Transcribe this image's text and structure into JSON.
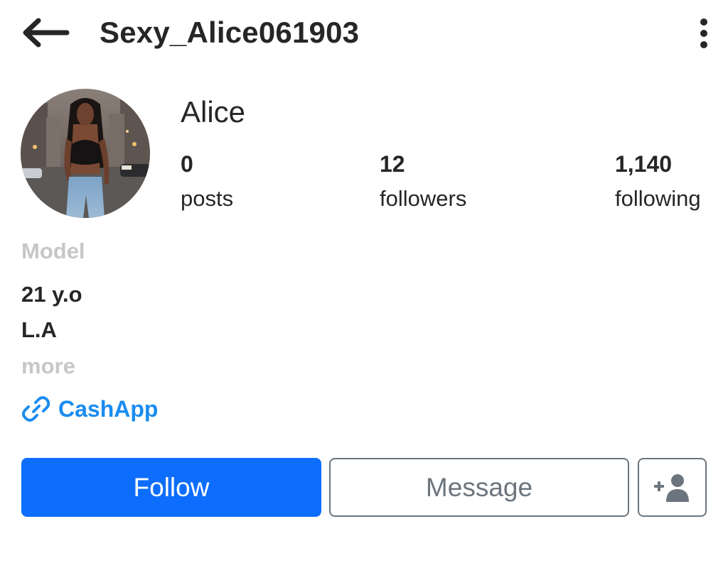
{
  "header": {
    "back_icon": "arrow-left-icon",
    "username": "Sexy_Alice061903",
    "more_icon": "kebab-vertical-icon"
  },
  "profile": {
    "avatar_icon": "profile-photo",
    "display_name": "Alice",
    "stats": [
      {
        "value": "0",
        "label": "posts"
      },
      {
        "value": "12",
        "label": "followers"
      },
      {
        "value": "1,140",
        "label": "following"
      }
    ]
  },
  "bio": {
    "category": "Model",
    "lines": [
      "21 y.o",
      "L.A"
    ],
    "more_label": "more",
    "link_icon": "link-icon",
    "link_label": "CashApp"
  },
  "actions": {
    "follow_label": "Follow",
    "message_label": "Message",
    "add_user_icon": "add-user-icon"
  },
  "colors": {
    "primary": "#0d6efd",
    "link": "#1a8cf0",
    "muted": "#c7c7c7",
    "text": "#262626",
    "border": "#6c757d"
  }
}
